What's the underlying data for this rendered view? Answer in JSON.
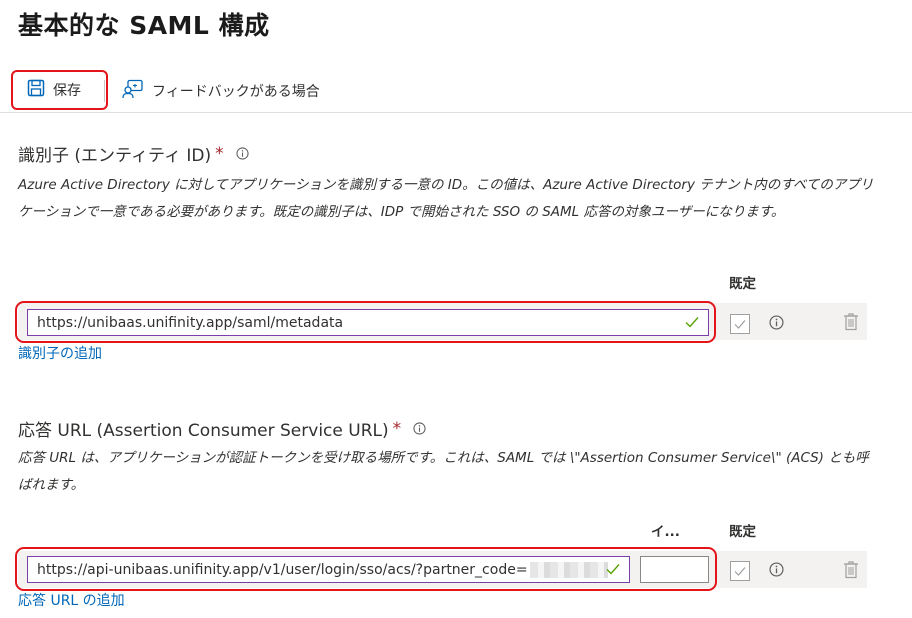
{
  "page": {
    "title": "基本的な SAML 構成"
  },
  "toolbar": {
    "save_label": "保存",
    "feedback_label": "フィードバックがある場合"
  },
  "identifier": {
    "title": "識別子 (エンティティ ID)",
    "required_mark": "*",
    "description": "Azure Active Directory に対してアプリケーションを識別する一意の ID。この値は、Azure Active Directory テナント内のすべてのアプリケーションで一意である必要があります。既定の識別子は、IDP で開始された SSO の SAML 応答の対象ユーザーになります。",
    "column_default": "既定",
    "value": "https://unibaas.unifinity.app/saml/metadata",
    "add_link": "識別子の追加"
  },
  "reply_url": {
    "title": "応答 URL (Assertion Consumer Service URL)",
    "required_mark": "*",
    "description": "応答 URL は、アプリケーションが認証トークンを受け取る場所です。これは、SAML では \\\"Assertion Consumer Service\\\" (ACS) とも呼ばれます。",
    "column_index": "イ...",
    "column_default": "既定",
    "value": "https://api-unibaas.unifinity.app/v1/user/login/sso/acs/?partner_code=",
    "index_value": "",
    "add_link": "応答 URL の追加"
  },
  "colors": {
    "highlight": "#e3151b",
    "link": "#0067b8",
    "valid_check": "#57a300",
    "input_focus_border": "#7a3fa8"
  },
  "icons": [
    "save-icon",
    "feedback-icon",
    "info-icon",
    "checkmark-icon",
    "trash-icon",
    "checkbox"
  ]
}
